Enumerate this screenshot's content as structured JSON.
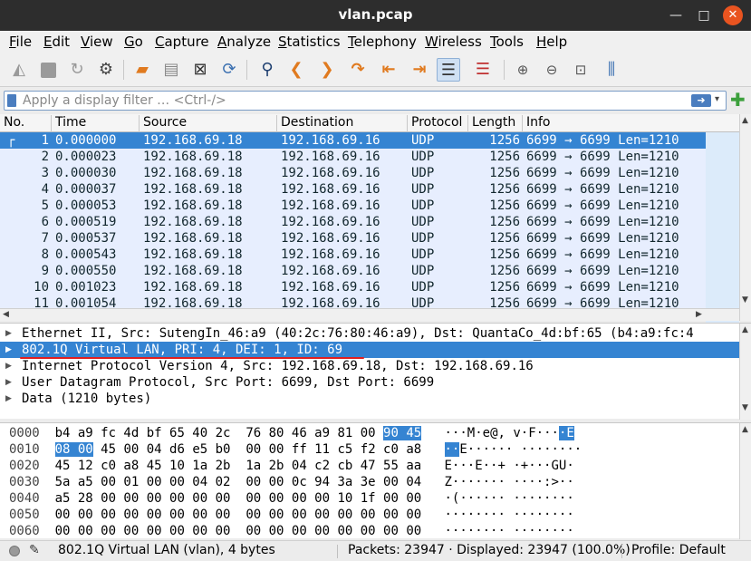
{
  "window": {
    "title": "vlan.pcap",
    "minimize": "—",
    "maximize": "□",
    "close": "✕"
  },
  "menu": [
    "File",
    "Edit",
    "View",
    "Go",
    "Capture",
    "Analyze",
    "Statistics",
    "Telephony",
    "Wireless",
    "Tools",
    "Help"
  ],
  "filter": {
    "placeholder": "Apply a display filter … <Ctrl-/>",
    "apply_icon": "arrow-right-icon",
    "add_icon": "plus-icon"
  },
  "columns": [
    "No.",
    "Time",
    "Source",
    "Destination",
    "Protocol",
    "Length",
    "Info"
  ],
  "packets": [
    {
      "no": "1",
      "time": "0.000000",
      "src": "192.168.69.18",
      "dst": "192.168.69.16",
      "proto": "UDP",
      "len": "1256",
      "info": "6699 → 6699 Len=1210"
    },
    {
      "no": "2",
      "time": "0.000023",
      "src": "192.168.69.18",
      "dst": "192.168.69.16",
      "proto": "UDP",
      "len": "1256",
      "info": "6699 → 6699 Len=1210"
    },
    {
      "no": "3",
      "time": "0.000030",
      "src": "192.168.69.18",
      "dst": "192.168.69.16",
      "proto": "UDP",
      "len": "1256",
      "info": "6699 → 6699 Len=1210"
    },
    {
      "no": "4",
      "time": "0.000037",
      "src": "192.168.69.18",
      "dst": "192.168.69.16",
      "proto": "UDP",
      "len": "1256",
      "info": "6699 → 6699 Len=1210"
    },
    {
      "no": "5",
      "time": "0.000053",
      "src": "192.168.69.18",
      "dst": "192.168.69.16",
      "proto": "UDP",
      "len": "1256",
      "info": "6699 → 6699 Len=1210"
    },
    {
      "no": "6",
      "time": "0.000519",
      "src": "192.168.69.18",
      "dst": "192.168.69.16",
      "proto": "UDP",
      "len": "1256",
      "info": "6699 → 6699 Len=1210"
    },
    {
      "no": "7",
      "time": "0.000537",
      "src": "192.168.69.18",
      "dst": "192.168.69.16",
      "proto": "UDP",
      "len": "1256",
      "info": "6699 → 6699 Len=1210"
    },
    {
      "no": "8",
      "time": "0.000543",
      "src": "192.168.69.18",
      "dst": "192.168.69.16",
      "proto": "UDP",
      "len": "1256",
      "info": "6699 → 6699 Len=1210"
    },
    {
      "no": "9",
      "time": "0.000550",
      "src": "192.168.69.18",
      "dst": "192.168.69.16",
      "proto": "UDP",
      "len": "1256",
      "info": "6699 → 6699 Len=1210"
    },
    {
      "no": "10",
      "time": "0.001023",
      "src": "192.168.69.18",
      "dst": "192.168.69.16",
      "proto": "UDP",
      "len": "1256",
      "info": "6699 → 6699 Len=1210"
    },
    {
      "no": "11",
      "time": "0.001054",
      "src": "192.168.69.18",
      "dst": "192.168.69.16",
      "proto": "UDP",
      "len": "1256",
      "info": "6699 → 6699 Len=1210"
    }
  ],
  "details": [
    "Ethernet II, Src: SutengIn_46:a9 (40:2c:76:80:46:a9), Dst: QuantaCo_4d:bf:65 (b4:a9:fc:4",
    "802.1Q Virtual LAN, PRI: 4, DEI: 1, ID: 69",
    "Internet Protocol Version 4, Src: 192.168.69.18, Dst: 192.168.69.16",
    "User Datagram Protocol, Src Port: 6699, Dst Port: 6699",
    "Data (1210 bytes)"
  ],
  "bytes": [
    {
      "off": "0000",
      "h1": "b4 a9 fc 4d bf 65 40 2c",
      "h2a": "76 80 46 a9 81 00",
      "h2hl": "90 45",
      "a1": "···M·e@, v·F···",
      "ahl": "·E"
    },
    {
      "off": "0010",
      "h1hl": "08 00",
      "h1": "45 00 04 d6 e5 b0",
      "h2": "00 00 ff 11 c5 f2 c0 a8",
      "ahl": "··",
      "a1": "E······ ········"
    },
    {
      "off": "0020",
      "h1": "45 12 c0 a8 45 10 1a 2b",
      "h2": "1a 2b 04 c2 cb 47 55 aa",
      "a": "E···E··+ ·+···GU·"
    },
    {
      "off": "0030",
      "h1": "5a a5 00 01 00 00 04 02",
      "h2": "00 00 0c 94 3a 3e 00 04",
      "a": "Z······· ····:>··"
    },
    {
      "off": "0040",
      "h1": "a5 28 00 00 00 00 00 00",
      "h2": "00 00 00 00 10 1f 00 00",
      "a": "·(······ ········"
    },
    {
      "off": "0050",
      "h1": "00 00 00 00 00 00 00 00",
      "h2": "00 00 00 00 00 00 00 00",
      "a": "········ ········"
    },
    {
      "off": "0060",
      "h1": "00 00 00 00 00 00 00 00",
      "h2": "00 00 00 00 00 00 00 00",
      "a": "········ ········"
    }
  ],
  "status": {
    "field": "802.1Q Virtual LAN (vlan), 4 bytes",
    "packets": "Packets: 23947 · Displayed: 23947 (100.0%)",
    "profile": "Profile: Default"
  }
}
